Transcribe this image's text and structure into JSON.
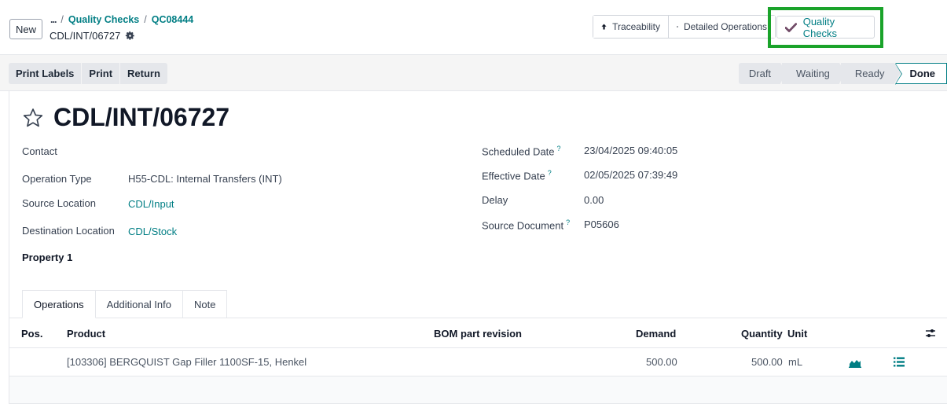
{
  "control_panel": {
    "new_label": "New",
    "breadcrumb": {
      "ellipsis": "...",
      "separator": "/",
      "items": [
        "Quality Checks",
        "QC08444"
      ]
    },
    "record_name": "CDL/INT/06727",
    "icons": {
      "settings": "gear-icon"
    }
  },
  "smart_buttons": {
    "traceability_label": "Traceability",
    "detailed_operations_label": "Detailed Operations",
    "quality_checks_label": "Quality Checks"
  },
  "action_bar": {
    "buttons": [
      "Print Labels",
      "Print",
      "Return"
    ],
    "stages": [
      "Draft",
      "Waiting",
      "Ready",
      "Done"
    ],
    "active_stage": "Done"
  },
  "record": {
    "title": "CDL/INT/06727",
    "left_fields": [
      {
        "label": "Contact",
        "value": ""
      },
      {
        "label": "Operation Type",
        "value": "H55-CDL: Internal Transfers (INT)"
      },
      {
        "label": "Source Location",
        "value": "CDL/Input"
      },
      {
        "label": "Destination Location",
        "value": "CDL/Stock"
      },
      {
        "label": "Property 1",
        "value": ""
      }
    ],
    "right_fields": [
      {
        "label": "Scheduled Date",
        "help": "?",
        "value": "23/04/2025 09:40:05"
      },
      {
        "label": "Effective Date",
        "help": "?",
        "value": "02/05/2025 07:39:49"
      },
      {
        "label": "Delay",
        "help": "",
        "value": "0.00"
      },
      {
        "label": "Source Document",
        "help": "?",
        "value": "P05606"
      }
    ]
  },
  "tabs": [
    "Operations",
    "Additional Info",
    "Note"
  ],
  "operations_table": {
    "columns": [
      "Pos.",
      "Product",
      "BOM part revision",
      "Demand",
      "Quantity",
      "Unit"
    ],
    "rows": [
      {
        "pos": "",
        "product": "[103306] BERGQUIST Gap Filler 1100SF-15, Henkel",
        "bom_part_revision": "",
        "demand": "500.00",
        "quantity": "500.00",
        "unit": "mL"
      }
    ]
  },
  "colors": {
    "accent": "#017e84",
    "highlight_box": "#1aa32a",
    "quality_check_mark": "#714b67"
  }
}
